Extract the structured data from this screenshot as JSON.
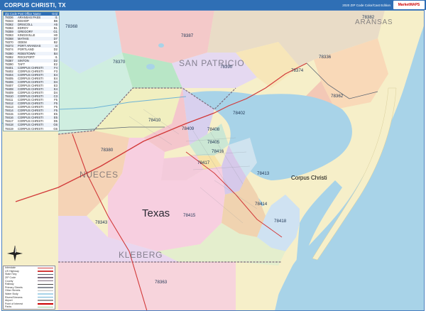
{
  "header": {
    "title": "CORPUS CHRISTI, TX",
    "edition": "2020 ZIP Code Color/Cast Edition",
    "brand": "MarketMAPS"
  },
  "zip_table": {
    "headers": [
      "Zip Code",
      "Post Office Name",
      "Grid"
    ],
    "rows": [
      [
        "78336",
        "ARANSAS PASS",
        "I1"
      ],
      [
        "78343",
        "BISHOP",
        "B6"
      ],
      [
        "78362",
        "DRISCOLL",
        "A5"
      ],
      [
        "78363",
        "EDROY",
        "B1"
      ],
      [
        "78359",
        "GREGORY",
        "G1"
      ],
      [
        "78363",
        "KINGSVILLE",
        "H0"
      ],
      [
        "78368",
        "MATHIS",
        "D7"
      ],
      [
        "78370",
        "ODEM",
        "B2"
      ],
      [
        "78373",
        "PORT ARANSAS",
        "I4"
      ],
      [
        "78374",
        "PORTLAND",
        "D2"
      ],
      [
        "78380",
        "ROBSTOWN",
        "B4"
      ],
      [
        "78382",
        "ROCKPORT",
        "I1"
      ],
      [
        "78387",
        "SINTON",
        "D2"
      ],
      [
        "78390",
        "TAFT",
        "E2"
      ],
      [
        "78401",
        "CORPUS CHRISTI",
        "F4"
      ],
      [
        "78402",
        "CORPUS CHRISTI",
        "F3"
      ],
      [
        "78404",
        "CORPUS CHRISTI",
        "E4"
      ],
      [
        "78405",
        "CORPUS CHRISTI",
        "E4"
      ],
      [
        "78406",
        "CORPUS CHRISTI",
        "D4"
      ],
      [
        "78407",
        "CORPUS CHRISTI",
        "E3"
      ],
      [
        "78408",
        "CORPUS CHRISTI",
        "E4"
      ],
      [
        "78409",
        "CORPUS CHRISTI",
        "D4"
      ],
      [
        "78410",
        "CORPUS CHRISTI",
        "C3"
      ],
      [
        "78411",
        "CORPUS CHRISTI",
        "F5"
      ],
      [
        "78412",
        "CORPUS CHRISTI",
        "F5"
      ],
      [
        "78413",
        "CORPUS CHRISTI",
        "F5"
      ],
      [
        "78414",
        "CORPUS CHRISTI",
        "F5"
      ],
      [
        "78415",
        "CORPUS CHRISTI",
        "E5"
      ],
      [
        "78416",
        "CORPUS CHRISTI",
        "E5"
      ],
      [
        "78417",
        "CORPUS CHRISTI",
        "D5"
      ],
      [
        "78418",
        "CORPUS CHRISTI",
        "G6"
      ],
      [
        "78419",
        "CORPUS CHRISTI",
        "G6"
      ]
    ]
  },
  "legend": {
    "items": [
      "Interstate",
      "US Highway",
      "State Hwy",
      "ZIP Code",
      "County",
      "Railway",
      "Primary Streets",
      "Other Streets",
      "Water Body",
      "Rivers/Streams",
      "Airport",
      "Point of Interest",
      "Parks"
    ]
  },
  "compass": {
    "north": "N"
  },
  "regions": {
    "san_patricio": "SAN PATRICIO",
    "aransas": "ARANSAS",
    "nueces": "NUECES",
    "kleberg": "KLEBERG",
    "state": "Texas",
    "city": "Corpus Christi"
  },
  "zips": {
    "z78368": "78368",
    "z78387": "78387",
    "z78382": "78382",
    "z78336": "78336",
    "z78370": "78370",
    "z78390": "78390",
    "z78374": "78374",
    "z78362": "78362",
    "z78402": "78402",
    "z78410": "78410",
    "z78409": "78409",
    "z78408": "78408",
    "z78405": "78405",
    "z78416": "78416",
    "z78417": "78417",
    "z78380": "78380",
    "z78415": "78415",
    "z78413": "78413",
    "z78414": "78414",
    "z78418": "78418",
    "z78343": "78343",
    "z78363": "78363"
  },
  "colors": {
    "water": "#a8d3e8",
    "land_base": "#f6efc9",
    "header": "#2f6fb5",
    "road_major": "#d23a3a",
    "road_minor": "#5a6470"
  }
}
